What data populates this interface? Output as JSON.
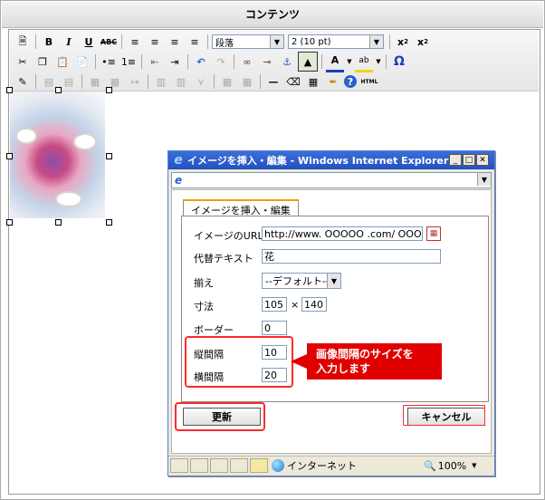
{
  "window_title": "コンテンツ",
  "toolbar": {
    "row1": {
      "format_select": "段落",
      "size_select": "2 (10 pt)"
    },
    "html_label": "HTML"
  },
  "icons": [
    "new-doc-icon",
    "bold-icon",
    "italic-icon",
    "underline-icon",
    "strikethrough-icon",
    "align-left-icon",
    "align-center-icon",
    "align-right-icon",
    "justify-icon",
    "subscript-icon",
    "superscript-icon",
    "cut-icon",
    "copy-icon",
    "paste-icon",
    "paste-text-icon",
    "bullet-list-icon",
    "numbered-list-icon",
    "outdent-icon",
    "indent-icon",
    "undo-icon",
    "redo-icon",
    "link-icon",
    "unlink-icon",
    "anchor-icon",
    "image-icon",
    "font-color-icon",
    "highlight-color-icon",
    "omega-icon",
    "edit-icon",
    "table-icon",
    "cleanup-icon",
    "help-icon"
  ],
  "ie_window": {
    "title": "イメージを挿入・編集 - Windows Internet Explorer",
    "tab_label": "イメージを挿入・編集",
    "fields": {
      "url_label": "イメージのURL",
      "url_value": "http://www. OOOOO .com/ OOOO",
      "alt_label": "代替テキスト",
      "alt_value": "花",
      "align_label": "揃え",
      "align_value": "--デフォルト--",
      "size_label": "寸法",
      "width_value": "105",
      "size_x": "×",
      "height_value": "140",
      "border_label": "ボーダー",
      "border_value": "0",
      "vspace_label": "縦間隔",
      "vspace_value": "10",
      "hspace_label": "横間隔",
      "hspace_value": "20"
    },
    "update_button": "更新",
    "cancel_button": "キャンセル",
    "status": {
      "zone": "インターネット",
      "zoom": "100%"
    }
  },
  "callout": {
    "line1": "画像間隔のサイズを",
    "line2": "入力します"
  },
  "colors": {
    "highlight_red": "#ff2a2a",
    "callout_bg": "#e00000",
    "ie_title_blue": "#2450c0"
  }
}
